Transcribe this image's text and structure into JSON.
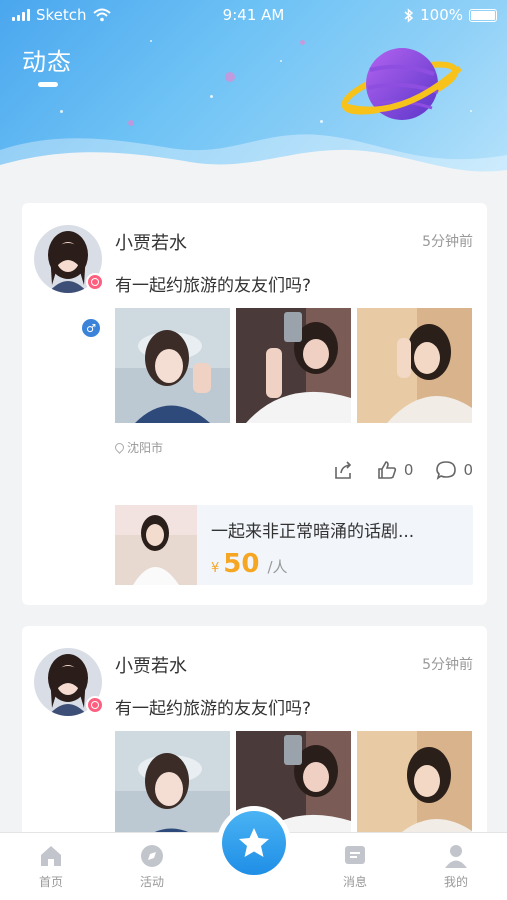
{
  "status_bar": {
    "carrier": "Sketch",
    "time": "9:41 AM",
    "battery": "100%"
  },
  "header": {
    "title": "动态"
  },
  "posts": [
    {
      "username": "小贾若水",
      "time_ago": "5分钟前",
      "text": "有一起约旅游的友友们吗?",
      "location": "沈阳市",
      "share_icon": "share-icon",
      "likes": "0",
      "comments": "0",
      "event": {
        "title": "一起来非正常暗涌的话剧...",
        "currency": "¥",
        "price": "50",
        "unit": "/人"
      }
    },
    {
      "username": "小贾若水",
      "time_ago": "5分钟前",
      "text": "有一起约旅游的友友们吗?"
    }
  ],
  "tabbar": {
    "items": [
      {
        "label": "首页",
        "icon": "home-icon"
      },
      {
        "label": "活动",
        "icon": "compass-icon"
      },
      {
        "label": "消息",
        "icon": "message-icon"
      },
      {
        "label": "我的",
        "icon": "user-icon"
      }
    ],
    "center_icon": "star-icon"
  },
  "colors": {
    "accent": "#1f8ee6",
    "price": "#f5a623",
    "verify": "#ff5f7e",
    "gender": "#3b82d9"
  }
}
